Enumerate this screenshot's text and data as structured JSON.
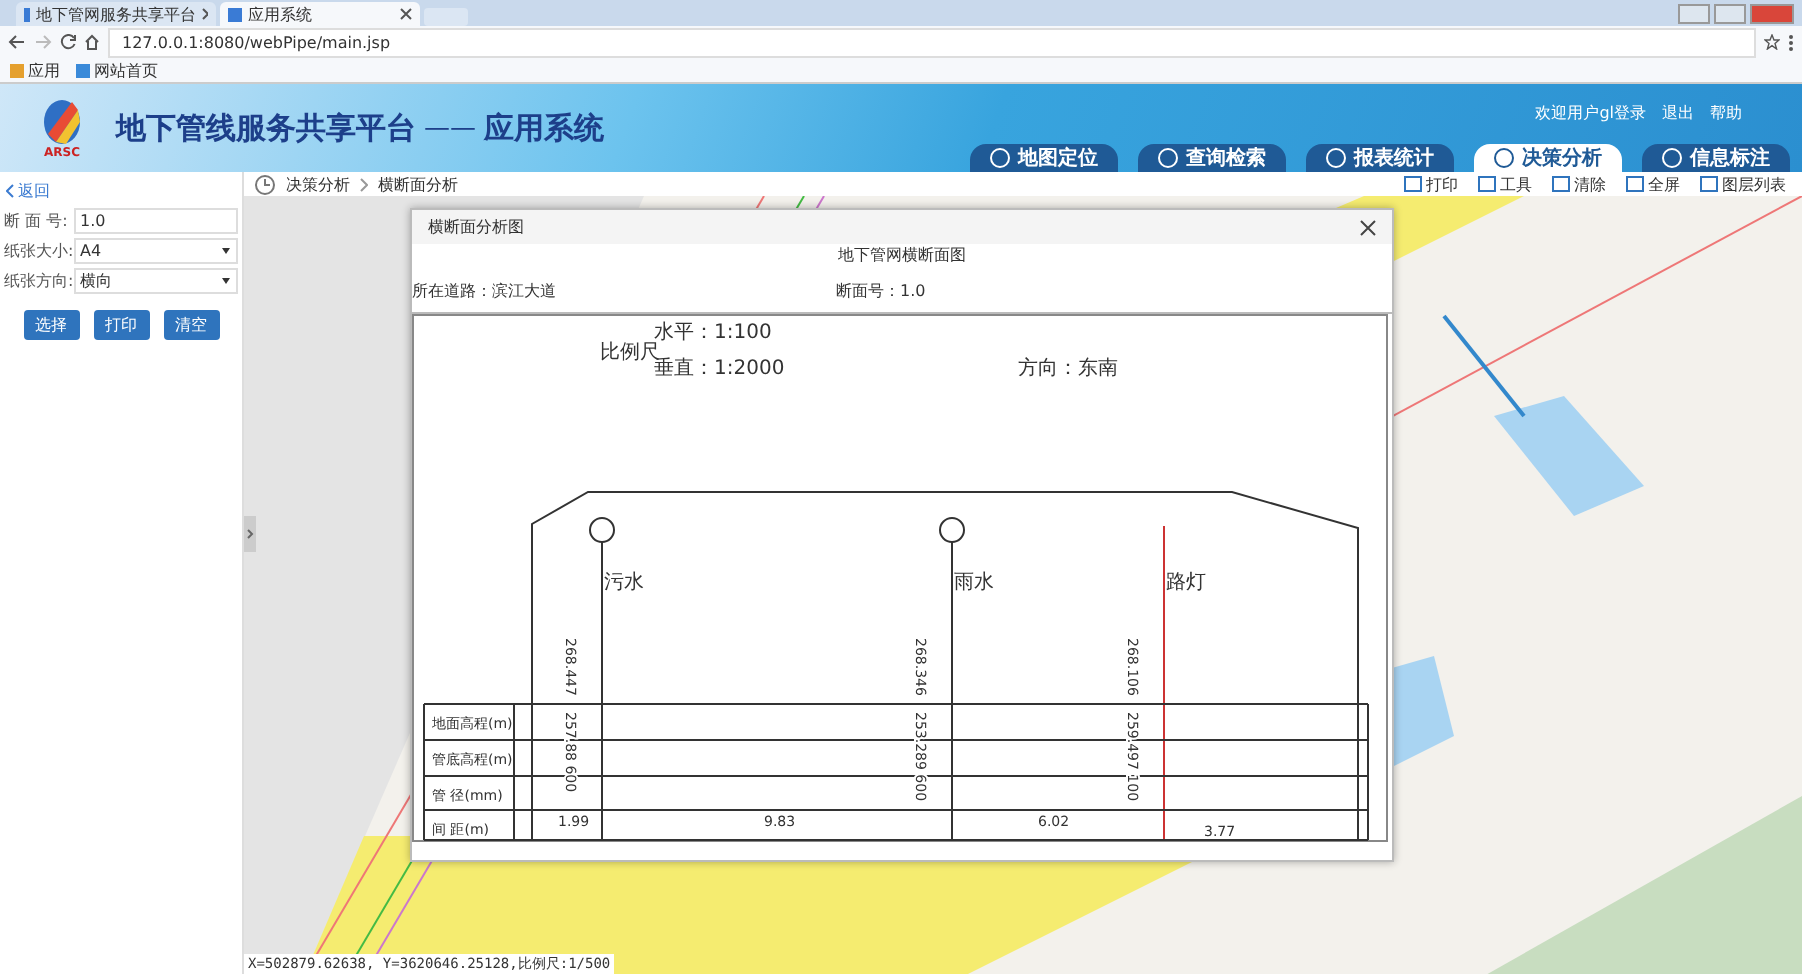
{
  "browser": {
    "tabs": [
      {
        "label": "地下管网服务共享平台",
        "selected": false
      },
      {
        "label": "应用系统",
        "selected": true
      }
    ],
    "address": "127.0.0.1:8080/webPipe/main.jsp",
    "bookmarks": [
      "应用",
      "网站首页"
    ]
  },
  "header": {
    "logo_text": "ARSC",
    "title": "地下管线服务共享平台",
    "dash": "——",
    "subtitle": "应用系统",
    "user_links": [
      "欢迎用户gl登录",
      "退出",
      "帮助"
    ],
    "nav_tabs": [
      {
        "label": "地图定位",
        "selected": false
      },
      {
        "label": "查询检索",
        "selected": false
      },
      {
        "label": "报表统计",
        "selected": false
      },
      {
        "label": "决策分析",
        "selected": true
      },
      {
        "label": "信息标注",
        "selected": false
      }
    ]
  },
  "toolbar": {
    "breadcrumb": [
      "决策分析",
      "横断面分析"
    ],
    "tools": [
      "打印",
      "工具",
      "清除",
      "全屏",
      "图层列表"
    ]
  },
  "sidebar": {
    "back": "返回",
    "fields": [
      {
        "kind": "input",
        "label": "断 面 号:",
        "value": "1.0"
      },
      {
        "kind": "select",
        "label": "纸张大小:",
        "value": "A4"
      },
      {
        "kind": "select",
        "label": "纸张方向:",
        "value": "横向"
      }
    ],
    "buttons": [
      "选择",
      "打印",
      "清空"
    ]
  },
  "dialog": {
    "title": "横断面分析图",
    "heading": "地下管网横断面图",
    "road": "所在道路：滨江大道",
    "section": "断面号：1.0",
    "scale_label": "比例尺",
    "horizontal": "水平：1:100",
    "vertical": "垂直：1:2000",
    "direction": "方向：东南",
    "pipes": [
      {
        "kind": "manhole",
        "name": "污水",
        "ground": "268.447",
        "bottom": "257.88 600"
      },
      {
        "kind": "manhole",
        "name": "雨水",
        "ground": "268.346",
        "bottom": "253.289 600"
      },
      {
        "kind": "cable",
        "name": "路灯",
        "ground": "268.106",
        "bottom": "259.497 100"
      }
    ],
    "row_labels": [
      "地面高程(m)",
      "管底高程(m)",
      "管 径(mm)",
      "间 距(m)"
    ],
    "distances": [
      "1.99",
      "9.83",
      "6.02",
      "3.77"
    ]
  },
  "status": "X=502879.62638, Y=3620646.25128,比例尺:1/500"
}
